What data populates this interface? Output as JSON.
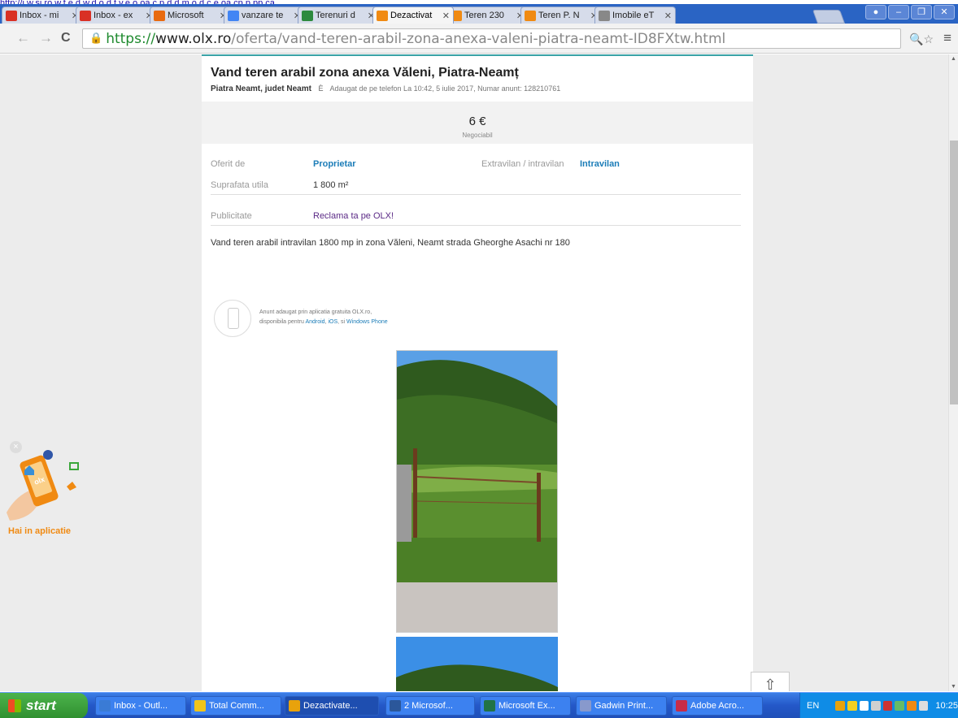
{
  "stray_url": "http://j.w.sj.ro.w.f.e.d.w.d.o.d.t.v.e.o.oa.c.p.d.d.m.o.d.c.e.oa.cp.p.pp.ca",
  "tabs": [
    {
      "label": "Inbox - mi",
      "icon": "gmail-icon",
      "color": "#d93025"
    },
    {
      "label": "Inbox - ex",
      "icon": "gmail-icon",
      "color": "#d93025"
    },
    {
      "label": "Microsoft",
      "icon": "office-icon",
      "color": "#e86a10"
    },
    {
      "label": "vanzare te",
      "icon": "google-icon",
      "color": "#4285f4"
    },
    {
      "label": "Terenuri d",
      "icon": "zz-icon",
      "color": "#2d8a3e"
    },
    {
      "label": "Dezactivat",
      "icon": "olx-icon",
      "color": "#f08a12",
      "active": true
    },
    {
      "label": "Teren 230",
      "icon": "olx-icon",
      "color": "#f08a12"
    },
    {
      "label": "Teren P. N",
      "icon": "olx-icon",
      "color": "#f08a12"
    },
    {
      "label": "Imobile eT",
      "icon": "page-icon",
      "color": "#888888"
    }
  ],
  "url": {
    "scheme": "https://",
    "host": "www.olx.ro",
    "path": "/oferta/vand-teren-arabil-zona-anexa-valeni-piatra-neamt-ID8FXtw.html"
  },
  "listing": {
    "title": "Vand teren arabil zona anexa Văleni, Piatra-Neamț",
    "location": "Piatra Neamt, judet Neamt",
    "added_info": "Adaugat de pe telefon La 10:42, 5 iulie 2017, Numar anunt: 128210761",
    "price": "6 €",
    "negotiable": "Negociabil",
    "details": {
      "offered_by_label": "Oferit de",
      "offered_by_value": "Proprietar",
      "extravilan_label": "Extravilan / intravilan",
      "extravilan_value": "Intravilan",
      "surface_label": "Suprafata utila",
      "surface_value": "1 800 m²",
      "ad_label": "Publicitate",
      "ad_value": "Reclama ta pe OLX!"
    },
    "description": "Vand teren arabil intravilan 1800 mp in zona Văleni, Neamt strada Gheorghe Asachi nr 180",
    "app_note_line1": "Anunt adaugat prin aplicatia gratuita OLX.ro,",
    "app_note_line2_prefix": "disponibila pentru",
    "app_android": "Android",
    "app_ios": "iOS",
    "app_sep": "si",
    "app_windows": "Windows Phone"
  },
  "promo": {
    "label": "Hai in aplicatie"
  },
  "taskbar": {
    "start": "start",
    "items": [
      {
        "label": "Inbox - Outl...",
        "color": "#3a7bd5"
      },
      {
        "label": "Total Comm...",
        "color": "#f0c419"
      },
      {
        "label": "Dezactivate...",
        "color": "#e8a20c",
        "active": true
      },
      {
        "label": "2 Microsof...",
        "color": "#2b579a"
      },
      {
        "label": "Microsoft Ex...",
        "color": "#217346"
      },
      {
        "label": "Gadwin Print...",
        "color": "#8899cc"
      },
      {
        "label": "Adobe Acro...",
        "color": "#c72c48"
      }
    ],
    "lang": "EN",
    "clock": "10:25"
  }
}
